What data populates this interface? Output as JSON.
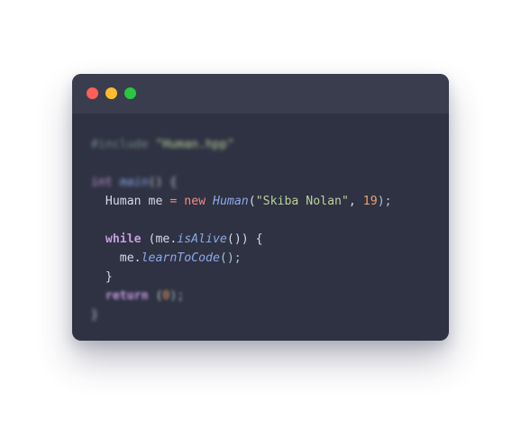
{
  "window": {
    "controls": [
      "close",
      "minimize",
      "maximize"
    ]
  },
  "code": {
    "lines": [
      {
        "tokens": [
          {
            "text": "#include",
            "kind": "comment"
          },
          {
            "text": " ",
            "kind": "plain"
          },
          {
            "text": "\"Human.hpp\"",
            "kind": "string"
          }
        ],
        "blur": "strong"
      },
      {
        "tokens": [],
        "blur": "none"
      },
      {
        "tokens": [
          {
            "text": "int",
            "kind": "type"
          },
          {
            "text": " ",
            "kind": "plain"
          },
          {
            "text": "main",
            "kind": "func"
          },
          {
            "text": "() {",
            "kind": "plain"
          }
        ],
        "blur": "strong"
      },
      {
        "tokens": [
          {
            "text": "  Human me ",
            "kind": "plain"
          },
          {
            "text": "=",
            "kind": "op"
          },
          {
            "text": " ",
            "kind": "plain"
          },
          {
            "text": "new",
            "kind": "new"
          },
          {
            "text": " ",
            "kind": "plain"
          },
          {
            "text": "Human",
            "kind": "func"
          },
          {
            "text": "(",
            "kind": "plain"
          },
          {
            "text": "\"Skiba Nolan\"",
            "kind": "string"
          },
          {
            "text": ", ",
            "kind": "plain"
          },
          {
            "text": "19",
            "kind": "number"
          },
          {
            "text": ");",
            "kind": "punct"
          }
        ],
        "blur": "none"
      },
      {
        "tokens": [],
        "blur": "none"
      },
      {
        "tokens": [
          {
            "text": "  ",
            "kind": "plain"
          },
          {
            "text": "while",
            "kind": "keyword"
          },
          {
            "text": " (me.",
            "kind": "plain"
          },
          {
            "text": "isAlive",
            "kind": "func"
          },
          {
            "text": "()) {",
            "kind": "plain"
          }
        ],
        "blur": "none"
      },
      {
        "tokens": [
          {
            "text": "    me.",
            "kind": "plain"
          },
          {
            "text": "learnToCode",
            "kind": "func"
          },
          {
            "text": "();",
            "kind": "punct"
          }
        ],
        "blur": "none"
      },
      {
        "tokens": [
          {
            "text": "  }",
            "kind": "plain"
          }
        ],
        "blur": "none"
      },
      {
        "tokens": [
          {
            "text": "  ",
            "kind": "plain"
          },
          {
            "text": "return",
            "kind": "keyword"
          },
          {
            "text": " (",
            "kind": "plain"
          },
          {
            "text": "0",
            "kind": "number"
          },
          {
            "text": ");",
            "kind": "punct"
          }
        ],
        "blur": "soft"
      },
      {
        "tokens": [
          {
            "text": "}",
            "kind": "plain"
          }
        ],
        "blur": "strong"
      }
    ]
  },
  "colors": {
    "background": "#ffffff",
    "window": "#2f3242",
    "titlebar": "#3a3d4e",
    "close": "#ff5f57",
    "minimize": "#febc2e",
    "maximize": "#28c840"
  }
}
